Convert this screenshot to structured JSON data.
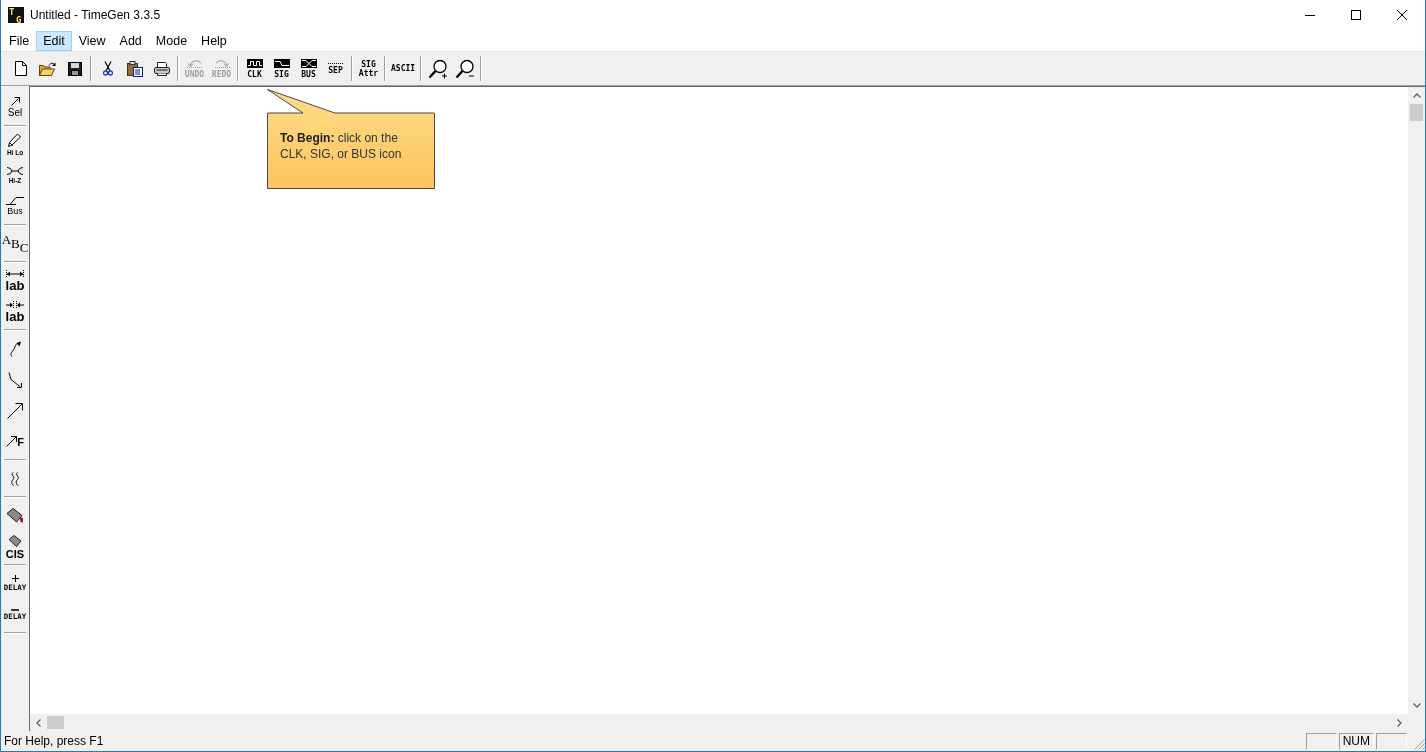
{
  "window": {
    "logo": "TG",
    "title": "Untitled - TimeGen 3.3.5"
  },
  "menu": [
    {
      "label": "File",
      "selected": false
    },
    {
      "label": "Edit",
      "selected": true
    },
    {
      "label": "View",
      "selected": false
    },
    {
      "label": "Add",
      "selected": false
    },
    {
      "label": "Mode",
      "selected": false
    },
    {
      "label": "Help",
      "selected": false
    }
  ],
  "toolbar": {
    "groups": [
      {
        "buttons": [
          {
            "kind": "new",
            "disabled": false
          },
          {
            "kind": "open",
            "disabled": false
          },
          {
            "kind": "save",
            "disabled": false
          }
        ]
      },
      {
        "buttons": [
          {
            "kind": "cut",
            "disabled": false
          },
          {
            "kind": "paste",
            "disabled": false
          },
          {
            "kind": "print",
            "disabled": false
          }
        ]
      },
      {
        "buttons": [
          {
            "kind": "undo",
            "label": "UNDO",
            "disabled": true
          },
          {
            "kind": "redo",
            "label": "REDO",
            "disabled": true
          }
        ]
      },
      {
        "buttons": [
          {
            "kind": "clk",
            "label": "CLK",
            "disabled": false
          },
          {
            "kind": "sig",
            "label": "SIG",
            "disabled": false
          },
          {
            "kind": "bus",
            "label": "BUS",
            "disabled": false
          },
          {
            "kind": "sep",
            "label": "SEP",
            "disabled": false
          }
        ]
      },
      {
        "buttons": [
          {
            "kind": "attr",
            "label": "SIG Attr",
            "disabled": false
          }
        ]
      },
      {
        "buttons": [
          {
            "kind": "ascii",
            "label": "ASCII",
            "disabled": false
          }
        ]
      },
      {
        "buttons": [
          {
            "kind": "zoom-in",
            "disabled": false
          },
          {
            "kind": "zoom-out",
            "disabled": false
          }
        ]
      }
    ]
  },
  "tool_palette": {
    "groups": [
      {
        "tools": [
          {
            "kind": "select",
            "label": "Sel"
          }
        ]
      },
      {
        "tools": [
          {
            "kind": "high-low",
            "label": "Hi Lo"
          },
          {
            "kind": "high-z",
            "label": "Hi-Z"
          },
          {
            "kind": "bus",
            "label": "Bus"
          }
        ]
      },
      {
        "tools": [
          {
            "kind": "text",
            "label": "ABC"
          }
        ]
      },
      {
        "tools": [
          {
            "kind": "label-outer",
            "label": "lab"
          },
          {
            "kind": "label-inner",
            "label": "lab"
          }
        ]
      },
      {
        "tools": [
          {
            "kind": "curve-arrow"
          },
          {
            "kind": "bent-arrow"
          },
          {
            "kind": "arrow"
          },
          {
            "kind": "arrow-label",
            "label": "F"
          }
        ]
      },
      {
        "tools": [
          {
            "kind": "break"
          }
        ]
      },
      {
        "tools": [
          {
            "kind": "fill"
          },
          {
            "kind": "fill-label",
            "label": "CIS"
          }
        ]
      },
      {
        "tools": [
          {
            "kind": "delay-add",
            "label": "DELAY"
          },
          {
            "kind": "delay-remove",
            "label": "DELAY"
          }
        ]
      }
    ]
  },
  "callout": {
    "text": "**To Begin:** click on the CLK, SIG, or BUS icon"
  },
  "status_bar": {
    "message": "For Help, press F1",
    "indicators": [
      {
        "kind": "blank"
      },
      {
        "kind": "text",
        "label": "NUM"
      },
      {
        "kind": "blank"
      }
    ]
  }
}
